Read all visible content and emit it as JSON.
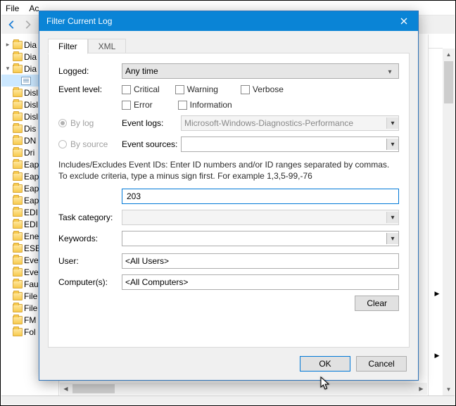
{
  "bg": {
    "menu": {
      "file": "File",
      "action": "Ac"
    },
    "tree": [
      {
        "t": "tw",
        "label": "Dia",
        "twist": ">"
      },
      {
        "t": "f",
        "label": "Dia",
        "twist": ""
      },
      {
        "t": "f",
        "label": "Dia",
        "twist": "v"
      },
      {
        "t": "sel",
        "label": ""
      },
      {
        "t": "f",
        "label": "Disl"
      },
      {
        "t": "f",
        "label": "Disl"
      },
      {
        "t": "f",
        "label": "Disl"
      },
      {
        "t": "f",
        "label": "Dis"
      },
      {
        "t": "f",
        "label": "DN"
      },
      {
        "t": "f",
        "label": "Dri"
      },
      {
        "t": "f",
        "label": "Eap"
      },
      {
        "t": "f",
        "label": "Eap"
      },
      {
        "t": "f",
        "label": "Eap"
      },
      {
        "t": "f",
        "label": "Eap"
      },
      {
        "t": "f",
        "label": "EDI"
      },
      {
        "t": "f",
        "label": "EDI"
      },
      {
        "t": "f",
        "label": "Ene"
      },
      {
        "t": "f",
        "label": "ESE"
      },
      {
        "t": "f",
        "label": "Eve"
      },
      {
        "t": "f",
        "label": "Eve"
      },
      {
        "t": "f",
        "label": "Fau"
      },
      {
        "t": "f",
        "label": "File"
      },
      {
        "t": "f",
        "label": "File"
      },
      {
        "t": "f",
        "label": "FM"
      },
      {
        "t": "f",
        "label": "Fol"
      }
    ]
  },
  "dialog": {
    "title": "Filter Current Log",
    "tabs": {
      "filter": "Filter",
      "xml": "XML"
    },
    "labels": {
      "logged": "Logged:",
      "event_level": "Event level:",
      "by_log": "By log",
      "by_source": "By source",
      "event_logs": "Event logs:",
      "event_sources": "Event sources:",
      "task_category": "Task category:",
      "keywords": "Keywords:",
      "user": "User:",
      "computers": "Computer(s):"
    },
    "logged_value": "Any time",
    "levels": {
      "critical": "Critical",
      "warning": "Warning",
      "verbose": "Verbose",
      "error": "Error",
      "information": "Information"
    },
    "event_logs_value": "Microsoft-Windows-Diagnostics-Performance",
    "event_sources_value": "",
    "help_text": "Includes/Excludes Event IDs: Enter ID numbers and/or ID ranges separated by commas. To exclude criteria, type a minus sign first. For example 1,3,5-99,-76",
    "event_id_value": "203",
    "task_category_value": "",
    "keywords_value": "",
    "user_value": "<All Users>",
    "computers_value": "<All Computers>",
    "buttons": {
      "clear": "Clear",
      "ok": "OK",
      "cancel": "Cancel"
    }
  }
}
